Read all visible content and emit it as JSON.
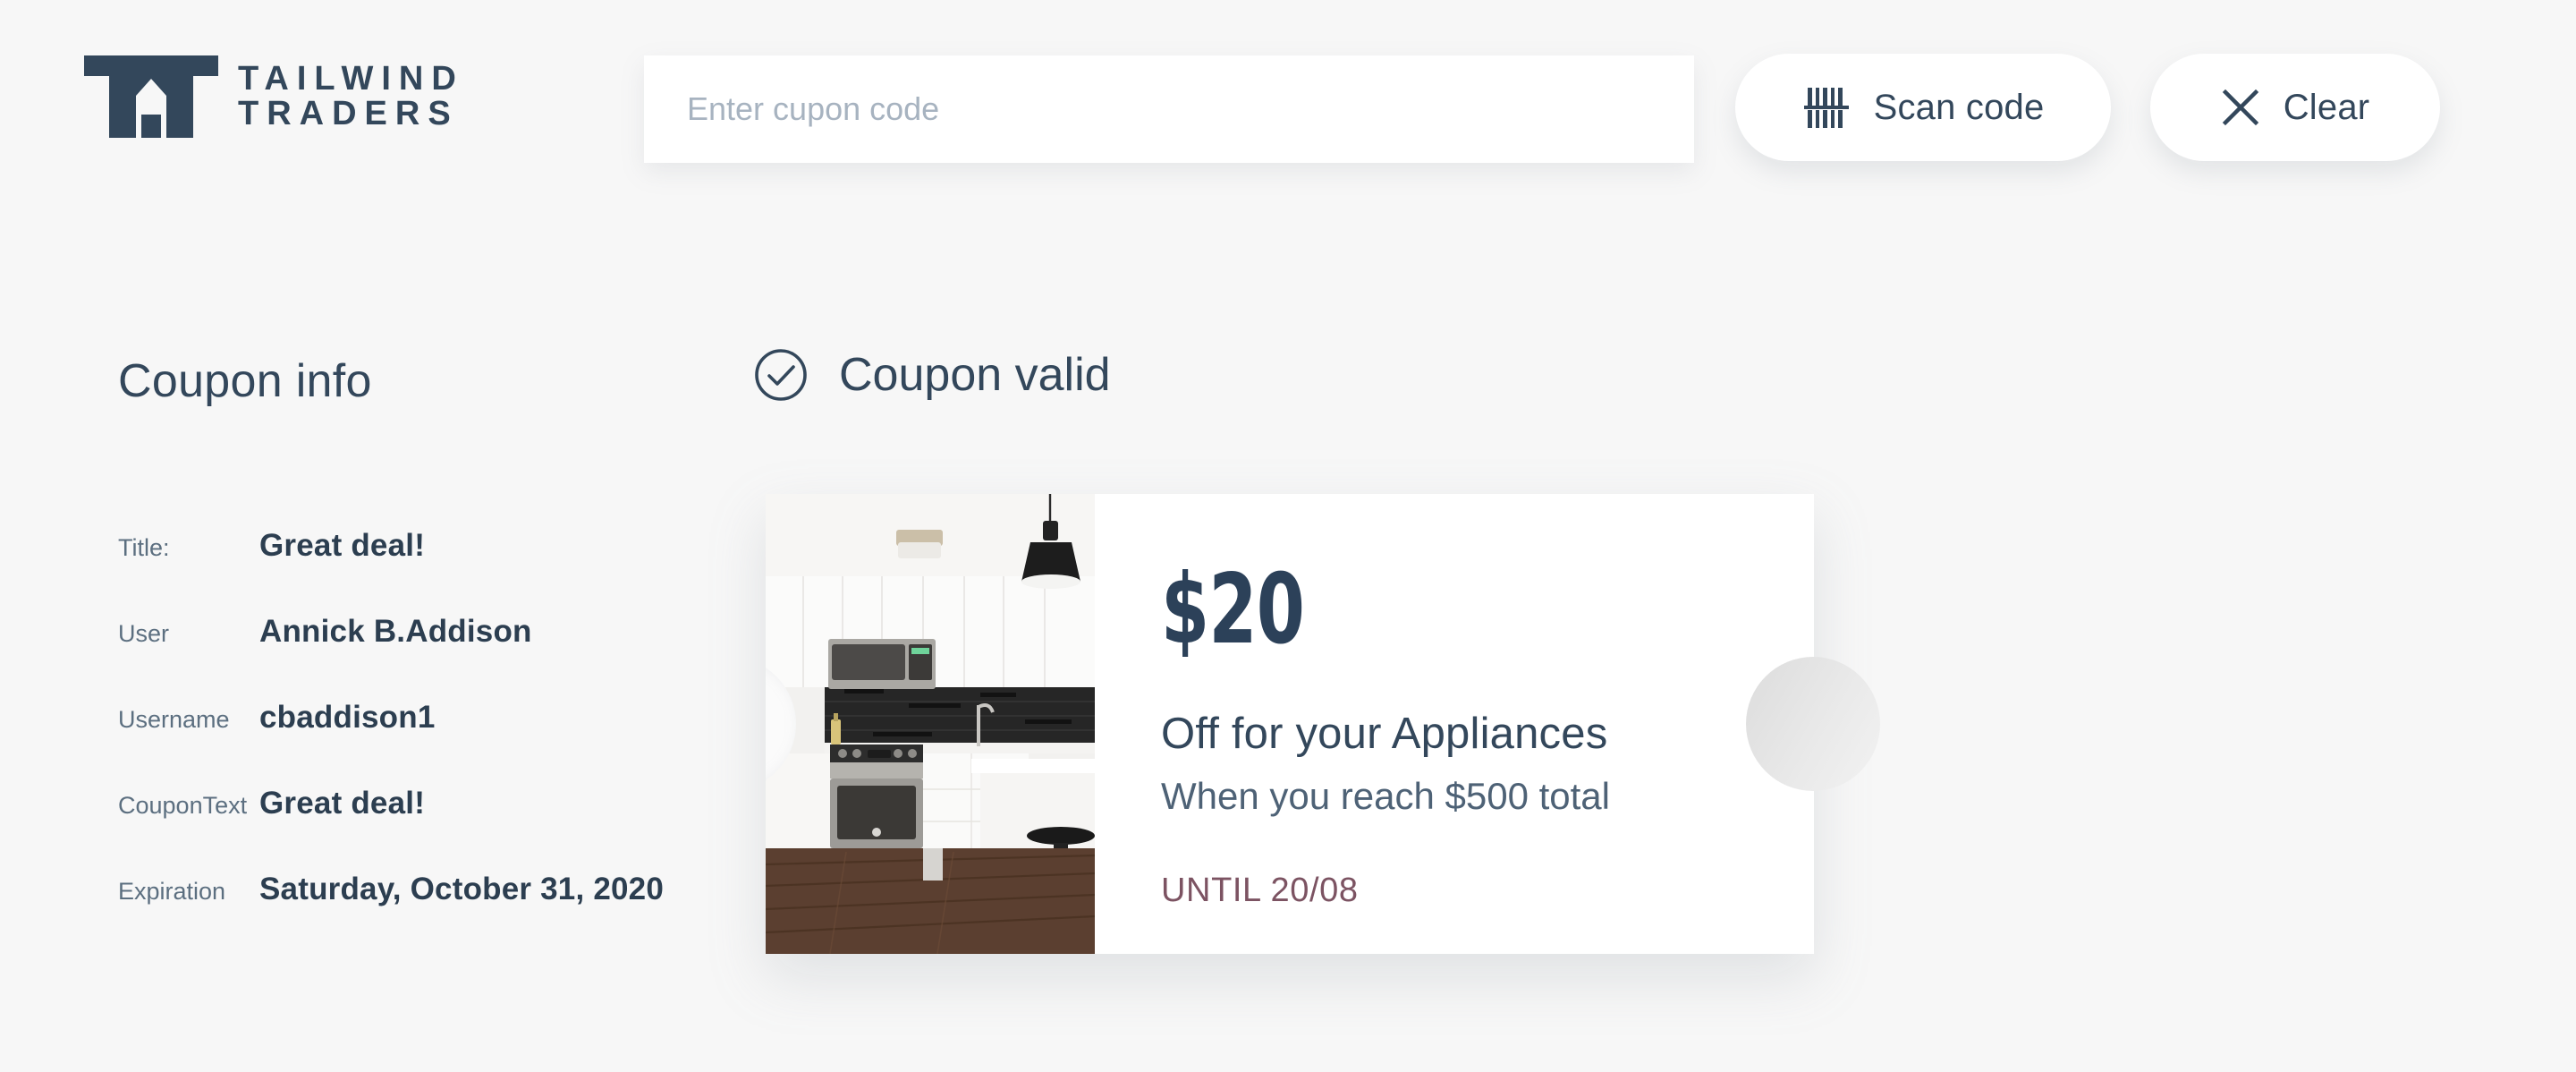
{
  "brand": {
    "name_line1": "TAILWIND",
    "name_line2": "TRADERS",
    "logo_icon": "tailwind-traders-house-logo",
    "color": "#33475b"
  },
  "header": {
    "search": {
      "placeholder": "Enter cupon code",
      "value": ""
    },
    "scan_button": {
      "label": "Scan code",
      "icon": "barcode-icon"
    },
    "clear_button": {
      "label": "Clear",
      "icon": "close-x-icon"
    }
  },
  "sidebar": {
    "title": "Coupon info",
    "fields": [
      {
        "label": "Title:",
        "value": "Great deal!"
      },
      {
        "label": "User",
        "value": "Annick B.Addison"
      },
      {
        "label": "Username",
        "value": "cbaddison1"
      },
      {
        "label": "CouponText",
        "value": "Great deal!"
      },
      {
        "label": "Expiration",
        "value": "Saturday, October 31, 2020"
      }
    ]
  },
  "status": {
    "icon": "check-circle-icon",
    "label": "Coupon valid"
  },
  "coupon": {
    "image_alt": "modern-kitchen-photo",
    "amount": "$20",
    "headline": "Off for your Appliances",
    "subline": "When you reach $500 total",
    "until": "UNTIL 20/08",
    "until_color": "#7c5362",
    "accent_color": "#2c4159"
  }
}
